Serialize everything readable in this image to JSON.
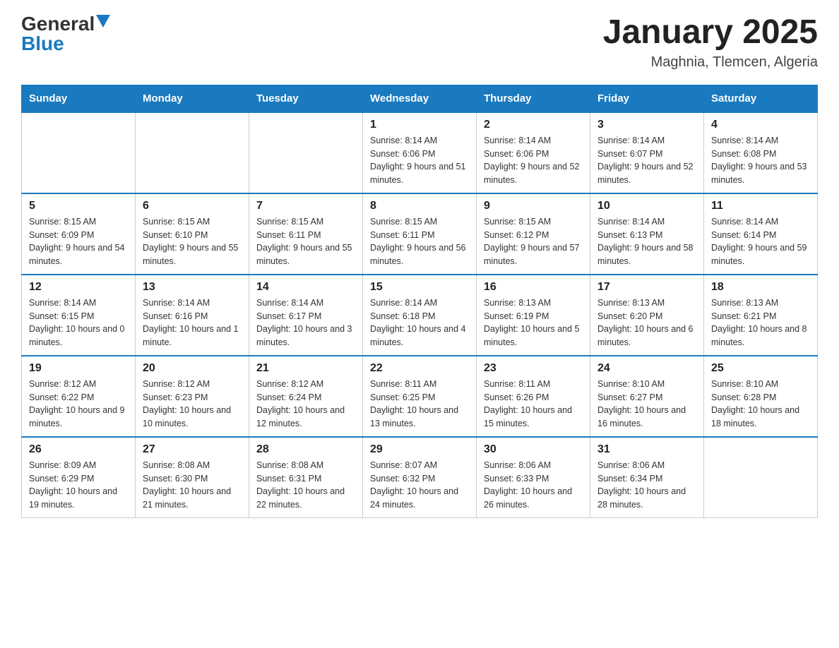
{
  "header": {
    "logo_general": "General",
    "logo_blue": "Blue",
    "month_title": "January 2025",
    "location": "Maghnia, Tlemcen, Algeria"
  },
  "days_of_week": [
    "Sunday",
    "Monday",
    "Tuesday",
    "Wednesday",
    "Thursday",
    "Friday",
    "Saturday"
  ],
  "weeks": [
    [
      {
        "day": "",
        "info": ""
      },
      {
        "day": "",
        "info": ""
      },
      {
        "day": "",
        "info": ""
      },
      {
        "day": "1",
        "info": "Sunrise: 8:14 AM\nSunset: 6:06 PM\nDaylight: 9 hours\nand 51 minutes."
      },
      {
        "day": "2",
        "info": "Sunrise: 8:14 AM\nSunset: 6:06 PM\nDaylight: 9 hours\nand 52 minutes."
      },
      {
        "day": "3",
        "info": "Sunrise: 8:14 AM\nSunset: 6:07 PM\nDaylight: 9 hours\nand 52 minutes."
      },
      {
        "day": "4",
        "info": "Sunrise: 8:14 AM\nSunset: 6:08 PM\nDaylight: 9 hours\nand 53 minutes."
      }
    ],
    [
      {
        "day": "5",
        "info": "Sunrise: 8:15 AM\nSunset: 6:09 PM\nDaylight: 9 hours\nand 54 minutes."
      },
      {
        "day": "6",
        "info": "Sunrise: 8:15 AM\nSunset: 6:10 PM\nDaylight: 9 hours\nand 55 minutes."
      },
      {
        "day": "7",
        "info": "Sunrise: 8:15 AM\nSunset: 6:11 PM\nDaylight: 9 hours\nand 55 minutes."
      },
      {
        "day": "8",
        "info": "Sunrise: 8:15 AM\nSunset: 6:11 PM\nDaylight: 9 hours\nand 56 minutes."
      },
      {
        "day": "9",
        "info": "Sunrise: 8:15 AM\nSunset: 6:12 PM\nDaylight: 9 hours\nand 57 minutes."
      },
      {
        "day": "10",
        "info": "Sunrise: 8:14 AM\nSunset: 6:13 PM\nDaylight: 9 hours\nand 58 minutes."
      },
      {
        "day": "11",
        "info": "Sunrise: 8:14 AM\nSunset: 6:14 PM\nDaylight: 9 hours\nand 59 minutes."
      }
    ],
    [
      {
        "day": "12",
        "info": "Sunrise: 8:14 AM\nSunset: 6:15 PM\nDaylight: 10 hours\nand 0 minutes."
      },
      {
        "day": "13",
        "info": "Sunrise: 8:14 AM\nSunset: 6:16 PM\nDaylight: 10 hours\nand 1 minute."
      },
      {
        "day": "14",
        "info": "Sunrise: 8:14 AM\nSunset: 6:17 PM\nDaylight: 10 hours\nand 3 minutes."
      },
      {
        "day": "15",
        "info": "Sunrise: 8:14 AM\nSunset: 6:18 PM\nDaylight: 10 hours\nand 4 minutes."
      },
      {
        "day": "16",
        "info": "Sunrise: 8:13 AM\nSunset: 6:19 PM\nDaylight: 10 hours\nand 5 minutes."
      },
      {
        "day": "17",
        "info": "Sunrise: 8:13 AM\nSunset: 6:20 PM\nDaylight: 10 hours\nand 6 minutes."
      },
      {
        "day": "18",
        "info": "Sunrise: 8:13 AM\nSunset: 6:21 PM\nDaylight: 10 hours\nand 8 minutes."
      }
    ],
    [
      {
        "day": "19",
        "info": "Sunrise: 8:12 AM\nSunset: 6:22 PM\nDaylight: 10 hours\nand 9 minutes."
      },
      {
        "day": "20",
        "info": "Sunrise: 8:12 AM\nSunset: 6:23 PM\nDaylight: 10 hours\nand 10 minutes."
      },
      {
        "day": "21",
        "info": "Sunrise: 8:12 AM\nSunset: 6:24 PM\nDaylight: 10 hours\nand 12 minutes."
      },
      {
        "day": "22",
        "info": "Sunrise: 8:11 AM\nSunset: 6:25 PM\nDaylight: 10 hours\nand 13 minutes."
      },
      {
        "day": "23",
        "info": "Sunrise: 8:11 AM\nSunset: 6:26 PM\nDaylight: 10 hours\nand 15 minutes."
      },
      {
        "day": "24",
        "info": "Sunrise: 8:10 AM\nSunset: 6:27 PM\nDaylight: 10 hours\nand 16 minutes."
      },
      {
        "day": "25",
        "info": "Sunrise: 8:10 AM\nSunset: 6:28 PM\nDaylight: 10 hours\nand 18 minutes."
      }
    ],
    [
      {
        "day": "26",
        "info": "Sunrise: 8:09 AM\nSunset: 6:29 PM\nDaylight: 10 hours\nand 19 minutes."
      },
      {
        "day": "27",
        "info": "Sunrise: 8:08 AM\nSunset: 6:30 PM\nDaylight: 10 hours\nand 21 minutes."
      },
      {
        "day": "28",
        "info": "Sunrise: 8:08 AM\nSunset: 6:31 PM\nDaylight: 10 hours\nand 22 minutes."
      },
      {
        "day": "29",
        "info": "Sunrise: 8:07 AM\nSunset: 6:32 PM\nDaylight: 10 hours\nand 24 minutes."
      },
      {
        "day": "30",
        "info": "Sunrise: 8:06 AM\nSunset: 6:33 PM\nDaylight: 10 hours\nand 26 minutes."
      },
      {
        "day": "31",
        "info": "Sunrise: 8:06 AM\nSunset: 6:34 PM\nDaylight: 10 hours\nand 28 minutes."
      },
      {
        "day": "",
        "info": ""
      }
    ]
  ]
}
